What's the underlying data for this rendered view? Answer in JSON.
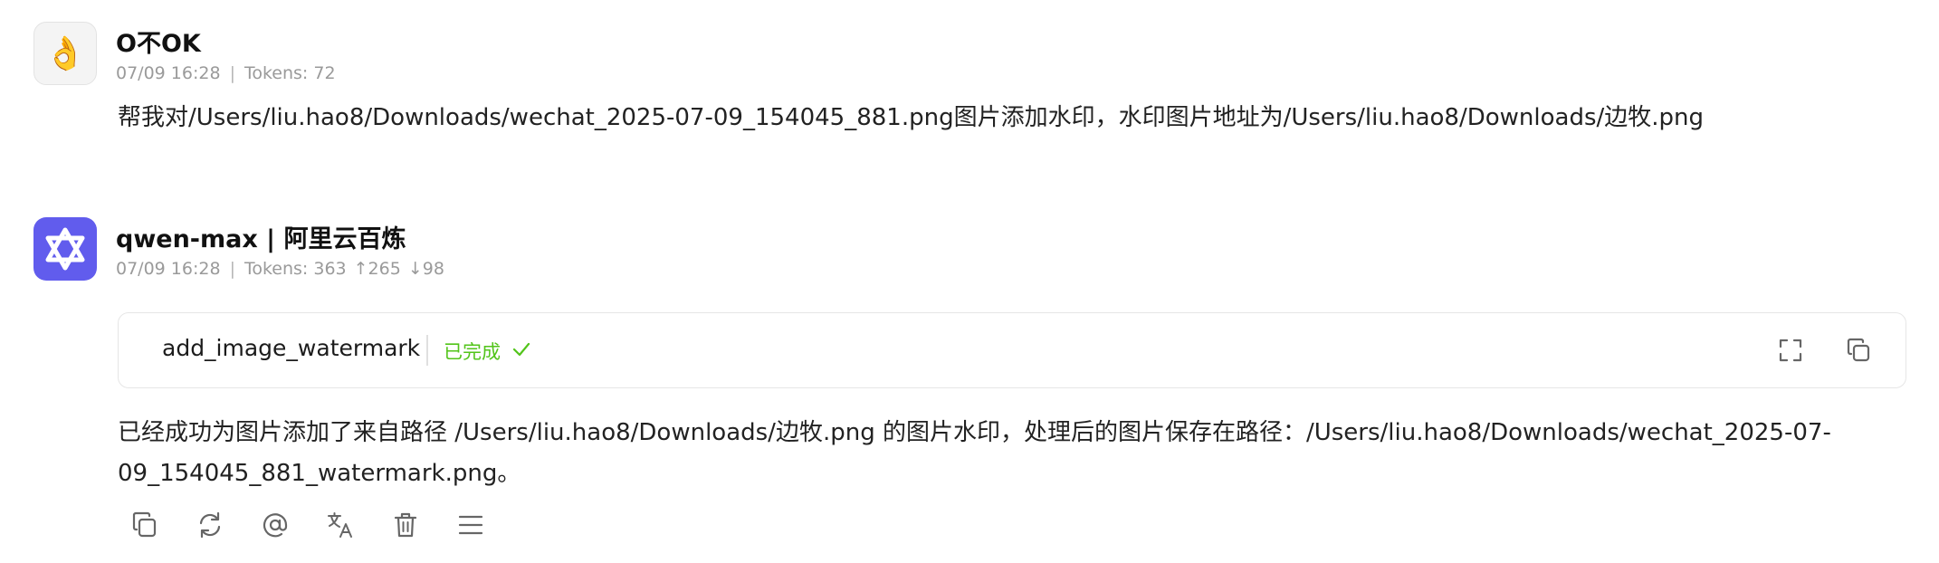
{
  "user_message": {
    "avatar_emoji": "👌",
    "name": "O不OK",
    "time": "07/09 16:28",
    "tokens": "Tokens: 72",
    "text": "帮我对/Users/liu.hao8/Downloads/wechat_2025-07-09_154045_881.png图片添加水印，水印图片地址为/Users/liu.hao8/Downloads/边牧.png"
  },
  "assistant_message": {
    "name": "qwen-max | 阿里云百炼",
    "time": "07/09 16:28",
    "tokens": "Tokens: 363",
    "tokens_up": "↑265",
    "tokens_down": "↓98",
    "tool_call": {
      "name": "add_image_watermark",
      "status": "已完成",
      "status_color": "#52c41a"
    },
    "text_line1": "已经成功为图片添加了来自路径 /Users/liu.hao8/Downloads/边牧.png 的图片水印，处理后的图片保存在路径：/Users/liu.hao8/Downloads/wechat_2025-07-",
    "text_line2": "09_154045_881_watermark.png。"
  },
  "separator": "|",
  "icons": {
    "user_avatar": "ok-hand-emoji",
    "assistant_avatar": "qwen-logo-icon",
    "status_check": "check-icon",
    "expand": "expand-icon",
    "card_copy": "copy-icon",
    "actions": [
      "copy-icon",
      "regenerate-icon",
      "mention-icon",
      "translate-icon",
      "delete-icon",
      "menu-icon"
    ]
  },
  "colors": {
    "accent": "#615ced",
    "muted_text": "#9a9a9a",
    "icon_gray": "#666666"
  }
}
